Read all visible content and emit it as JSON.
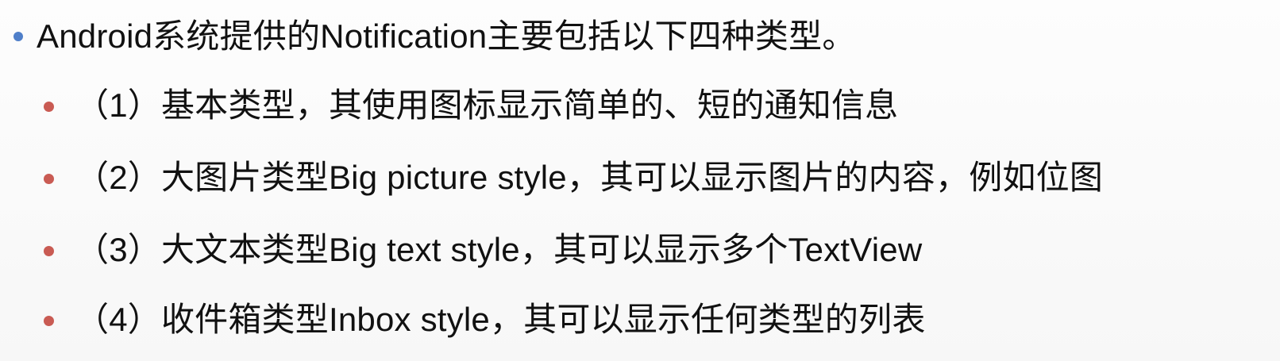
{
  "slide": {
    "heading": "Android系统提供的Notification主要包括以下四种类型。",
    "items": [
      "（1）基本类型，其使用图标显示简单的、短的通知信息",
      "（2）大图片类型Big picture style，其可以显示图片的内容，例如位图",
      "（3）大文本类型Big text style，其可以显示多个TextView",
      "（4）收件箱类型Inbox style，其可以显示任何类型的列表"
    ]
  },
  "colors": {
    "level1_bullet": "#4f7fc9",
    "level2_bullet": "#c95b53",
    "text": "#111111"
  }
}
